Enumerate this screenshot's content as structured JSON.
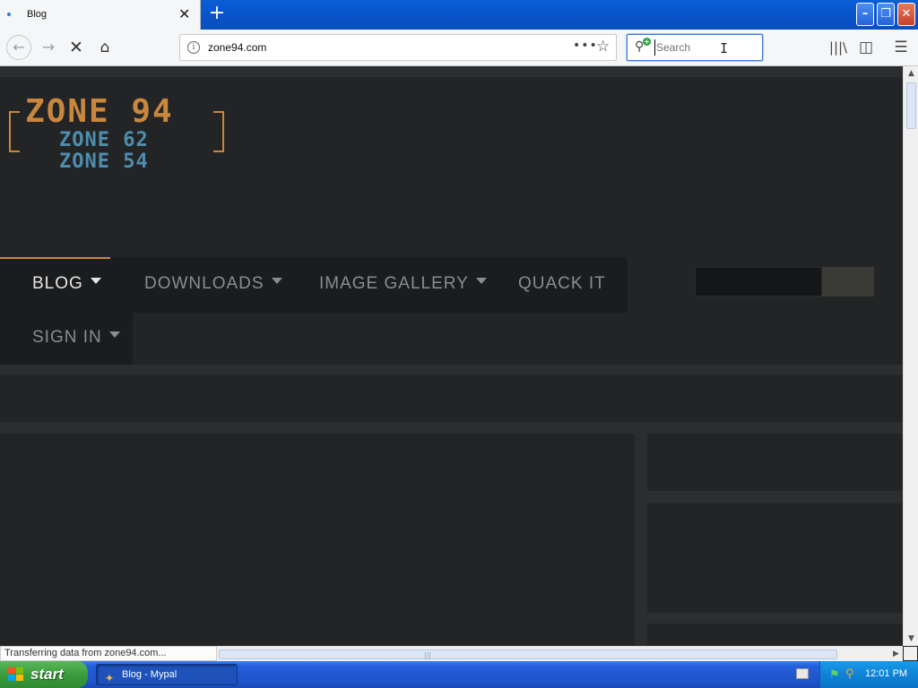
{
  "browser": {
    "tab_title": "Blog",
    "tab_close": "✕",
    "new_tab": "+",
    "url": "zone94.com",
    "search_placeholder": "Search",
    "status_text": "Transferring data from zone94.com..."
  },
  "site": {
    "logo_main": "ZONE 94",
    "logo_sub1": "ZONE 62",
    "logo_sub2": "ZONE 54",
    "menu": [
      {
        "label": "BLOG",
        "has_caret": true,
        "active": true
      },
      {
        "label": "DOWNLOADS",
        "has_caret": true,
        "active": false
      },
      {
        "label": "IMAGE GALLERY",
        "has_caret": true,
        "active": false
      },
      {
        "label": "QUACK IT",
        "has_caret": false,
        "active": false
      },
      {
        "label": "SIGN IN",
        "has_caret": true,
        "active": false
      }
    ]
  },
  "taskbar": {
    "start_label": "start",
    "task_label": "Blog - Mypal",
    "clock": "12:01 PM"
  },
  "colors": {
    "accent_orange": "#c9873d",
    "logo_blue": "#4f8eaf",
    "page_bg": "#232426",
    "menu_bg": "#1b1c1e"
  },
  "icons": [
    "back-arrow-icon",
    "forward-arrow-icon",
    "stop-icon",
    "home-icon",
    "info-icon",
    "page-actions-icon",
    "bookmark-star-icon",
    "search-engine-icon",
    "library-icon",
    "sidebar-icon",
    "hamburger-menu-icon"
  ]
}
